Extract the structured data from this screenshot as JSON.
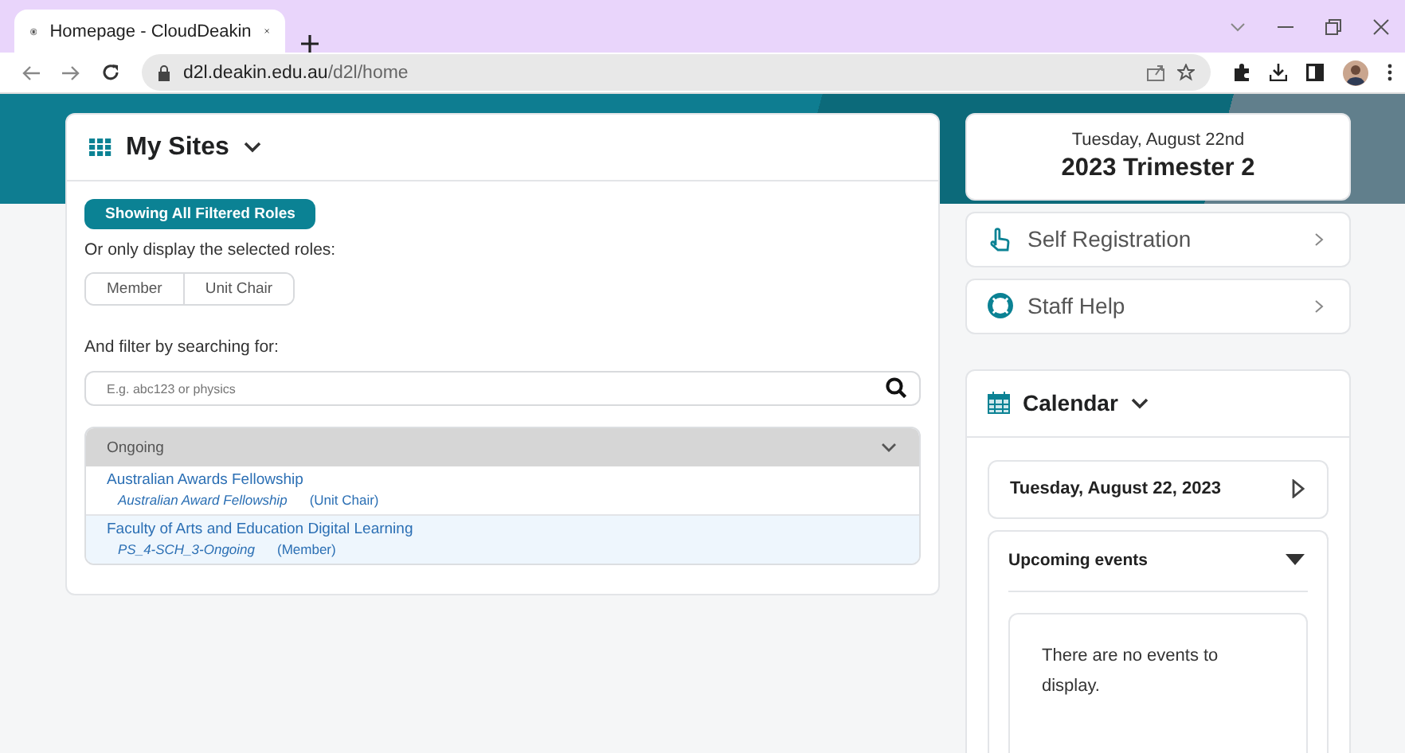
{
  "browser": {
    "tab_title": "Homepage - CloudDeakin",
    "url_domain": "d2l.deakin.edu.au",
    "url_path": "/d2l/home"
  },
  "my_sites": {
    "title": "My Sites",
    "filter_button": "Showing All Filtered Roles",
    "roles_label": "Or only display the selected roles:",
    "roles": [
      {
        "label": "Member",
        "selected": false
      },
      {
        "label": "Unit Chair",
        "selected": false
      }
    ],
    "search_label": "And filter by searching for:",
    "search": {
      "placeholder": "E.g. abc123 or physics"
    },
    "group": {
      "title": "Ongoing",
      "expanded": true,
      "items": [
        {
          "name": "Australian Awards Fellowship",
          "code": "Australian Award Fellowship",
          "role": "(Unit Chair)",
          "selected": false
        },
        {
          "name": "Faculty of Arts and Education Digital Learning",
          "code": "PS_4-SCH_3-Ongoing",
          "role": "(Member)",
          "selected": true
        }
      ]
    }
  },
  "term": {
    "date": "Tuesday, August 22nd",
    "title": "2023 Trimester 2"
  },
  "links": [
    {
      "kind": "hand",
      "label": "Self Registration"
    },
    {
      "kind": "lifebuoy",
      "label": "Staff Help"
    }
  ],
  "calendar": {
    "title": "Calendar",
    "date": "Tuesday, August 22, 2023",
    "upcoming": {
      "title": "Upcoming events",
      "expanded": true,
      "message": "There are no events to display."
    }
  }
}
